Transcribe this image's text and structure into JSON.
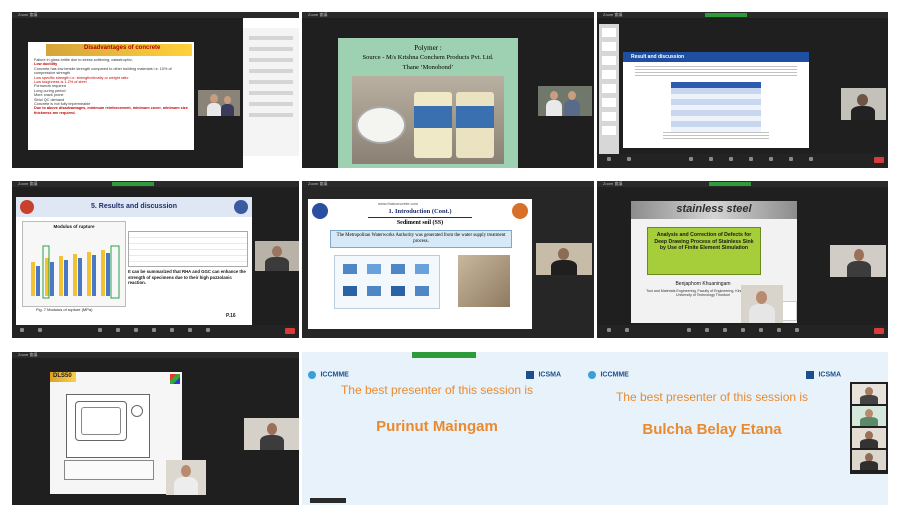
{
  "cell1": {
    "title": "Disadvantages of concrete",
    "bullets": [
      "Failure in glass brittle due to stress softening, catastrophic,",
      "Low ductility",
      "Concrete has low tensile strength compared to other building materials i.e. 10% of compressive strength",
      "Low specific strength i.e. strength/density or weight ratio",
      "Low toughness is 1-2% of steel",
      "Formwork required",
      "Long curing period",
      "More crack prone",
      "Strict QC demand",
      "Concrete is not fully impermeable",
      "Due to above disadvantages, minimum reinforcement, minimum cover, minimum size thickness are required."
    ]
  },
  "cell2": {
    "line1": "Polymer :",
    "line2": "Source - M/s Krishna Conchem Products Pvt. Ltd.",
    "line3": "Thane ‘Monobond’"
  },
  "cell3": {
    "title": "Result and discussion"
  },
  "cell4": {
    "title": "5. Results and discussion",
    "chart_label": "Modulus of rupture",
    "fig_caption": "Fig. 7 Modulus of rupture (MPa)",
    "note": "It can be summarized that RHA and GGC can enhance the strength of specimens due to their high pozzolanic reaction.",
    "page": "P.16"
  },
  "cell5": {
    "watermark": "www.thaiconcrete.com",
    "heading": "1. Introduction (Cont.)",
    "subheading": "Sediment soil (SS)",
    "body": "The Metropolitan Waterworks Authority was generated from the water supply treatment process."
  },
  "cell6": {
    "brand": "stainless steel",
    "title": "Analysis and Correction of Defects for Deep Drawing Process of Stainless Sink by Use of Finite Element Simulation",
    "author": "Benjaphorn Khuaningam",
    "affil": "Tool and Materials Engineering, Faculty of Engineering, King Mongkut's University of Technology Thonburi"
  },
  "cell7": {
    "label": "DLS50"
  },
  "award1": {
    "org_left": "ICCMME",
    "org_right": "ICSMA",
    "line": "The best presenter of this session is",
    "name": "Purinut Maingam"
  },
  "award2": {
    "org_left": "ICCMME",
    "org_right": "ICSMA",
    "line": "The best presenter of this session is",
    "name": "Bulcha Belay Etana"
  },
  "colors": {
    "award_text": "#ea8a2e",
    "award_bg": "#e7f2fb",
    "zoom_bg": "#1f1f1f",
    "record_green": "#2e9a3a",
    "end_red": "#d93a3a"
  }
}
